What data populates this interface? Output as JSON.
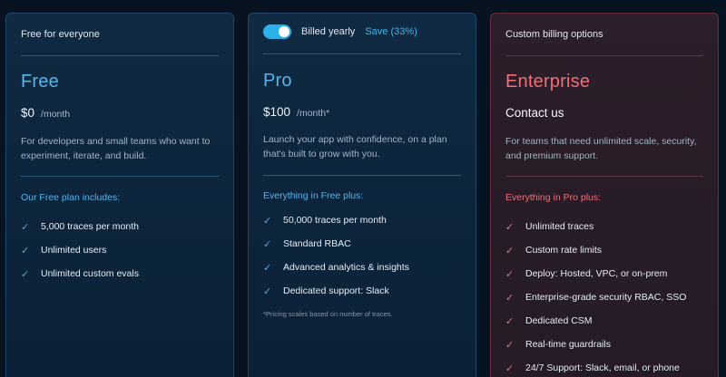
{
  "free": {
    "tagline": "Free for everyone",
    "name": "Free",
    "price": "$0",
    "period": "/month",
    "description": "For developers and small teams who want to experiment, iterate, and build.",
    "includes_label": "Our Free plan includes:",
    "features": [
      "5,000 traces per month",
      "Unlimited users",
      "Unlimited custom evals"
    ]
  },
  "pro": {
    "billing_label": "Billed yearly",
    "save_label": "Save (33%)",
    "billed_yearly_on": true,
    "name": "Pro",
    "price": "$100",
    "period": "/month*",
    "description": "Launch your app with confidence, on a plan that's built to grow with you.",
    "includes_label": "Everything in Free plus:",
    "features": [
      "50,000 traces per month",
      "Standard RBAC",
      "Advanced analytics & insights",
      "Dedicated support: Slack"
    ],
    "footnote": "*Pricing scales based on number of traces."
  },
  "enterprise": {
    "tagline": "Custom billing options",
    "name": "Enterprise",
    "contact": "Contact us",
    "description": "For teams that need unlimited scale, security, and premium support.",
    "includes_label": "Everything in Pro plus:",
    "features": [
      "Unlimited traces",
      "Custom rate limits",
      "Deploy: Hosted, VPC, or on-prem",
      "Enterprise-grade security RBAC, SSO",
      "Dedicated CSM",
      "Real-time guardrails",
      "24/7 Support: Slack, email, or phone"
    ]
  },
  "icons": {
    "feature": "check-icon"
  },
  "colors": {
    "background": "#081321",
    "free_accent": "#52b8ef",
    "pro_accent": "#5ab4ea",
    "toggle": "#2cb0e8",
    "enterprise_accent": "#ef6f77"
  }
}
